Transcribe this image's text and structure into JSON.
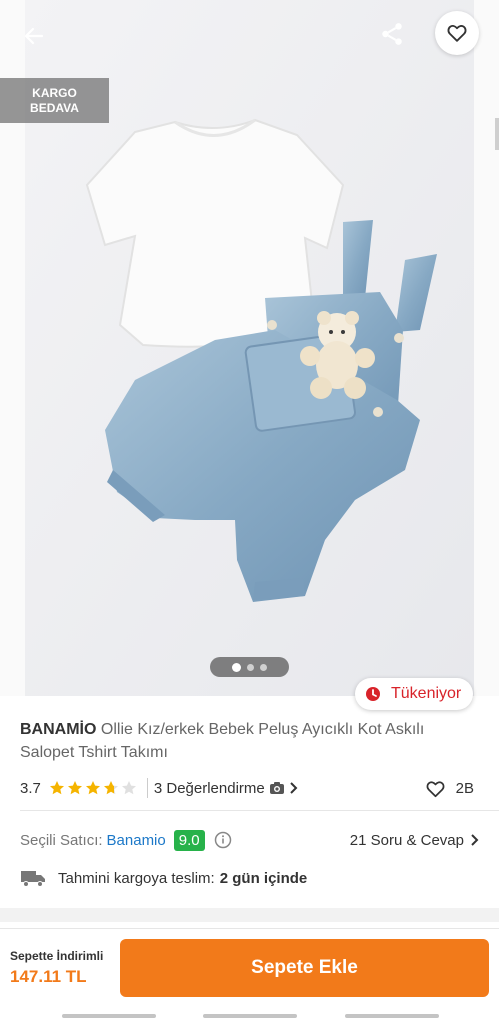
{
  "header": {
    "back_icon": "arrow-left-icon",
    "share_icon": "share-icon",
    "favorite_icon": "heart-outline-icon"
  },
  "gallery": {
    "badge_line1": "KARGO",
    "badge_line2": "BEDAVA",
    "image_count": 3,
    "active_index": 0
  },
  "stock_badge": {
    "icon": "clock-icon",
    "label": "Tükeniyor"
  },
  "product": {
    "brand": "BANAMİO",
    "name": "Ollie Kız/erkek Bebek Peluş Ayıcıklı Kot Askılı Salopet Tshirt Takımı",
    "rating": "3.7",
    "rating_value": 3.7,
    "reviews_label": "3 Değerlendirme",
    "likes": "2B"
  },
  "seller": {
    "label": "Seçili Satıcı:",
    "name": "Banamio",
    "score": "9.0",
    "qa_label": "21 Soru & Cevap"
  },
  "shipping": {
    "label": "Tahmini kargoya teslim:",
    "value": "2 gün içinde"
  },
  "cart": {
    "price_label": "Sepette İndirimli",
    "price": "147.11 TL",
    "button_label": "Sepete Ekle"
  },
  "colors": {
    "accent": "#f27a1a",
    "danger": "#d8232a",
    "seller_link": "#1c78c8",
    "score_green": "#27b24a",
    "star": "#f5b400"
  }
}
